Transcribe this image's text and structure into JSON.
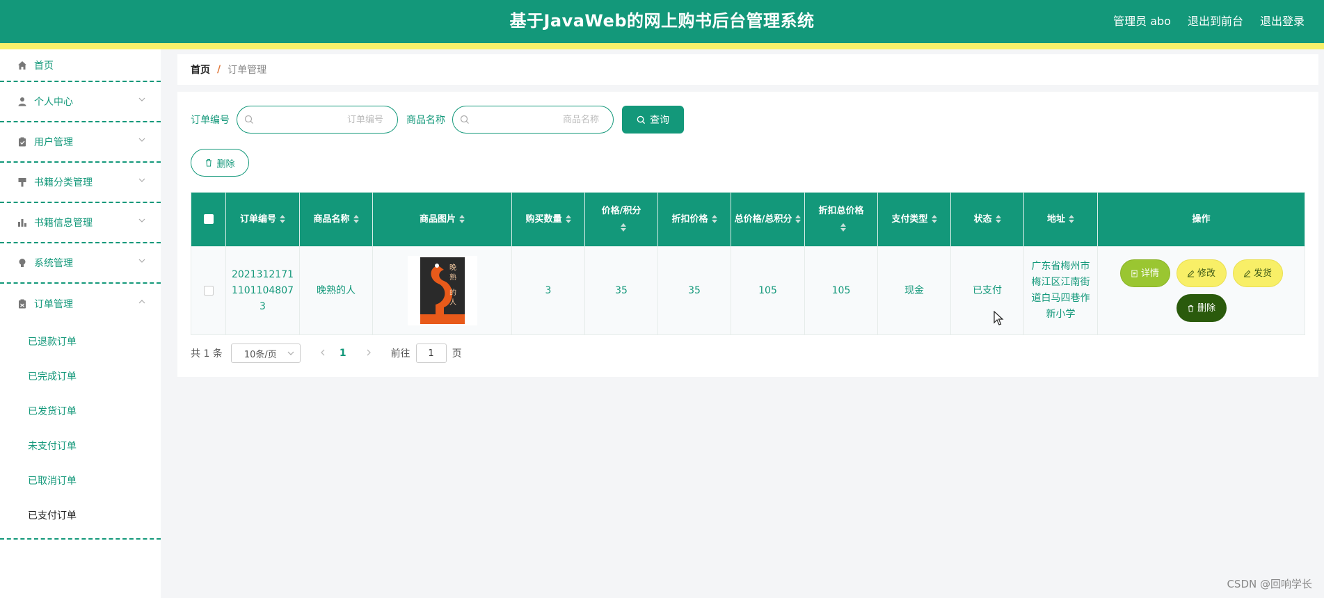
{
  "header": {
    "title": "基于JavaWeb的网上购书后台管理系统",
    "admin_label": "管理员 abo",
    "to_front": "退出到前台",
    "logout": "退出登录"
  },
  "sidebar": {
    "items": [
      {
        "label": "首页",
        "icon": "home-icon"
      },
      {
        "label": "个人中心",
        "icon": "user-icon"
      },
      {
        "label": "用户管理",
        "icon": "clipboard-icon"
      },
      {
        "label": "书籍分类管理",
        "icon": "brush-icon"
      },
      {
        "label": "书籍信息管理",
        "icon": "bar-chart-icon"
      },
      {
        "label": "系统管理",
        "icon": "bulb-icon"
      },
      {
        "label": "订单管理",
        "icon": "order-icon"
      }
    ],
    "subitems": [
      "已退款订单",
      "已完成订单",
      "已发货订单",
      "未支付订单",
      "已取消订单",
      "已支付订单"
    ]
  },
  "breadcrumb": {
    "home": "首页",
    "separator": "/",
    "current": "订单管理"
  },
  "search": {
    "order_label": "订单编号",
    "order_placeholder": "订单编号",
    "product_label": "商品名称",
    "product_placeholder": "商品名称",
    "query_button": "查询"
  },
  "delete_button": "删除",
  "table": {
    "headers": [
      "订单编号",
      "商品名称",
      "商品图片",
      "购买数量",
      "价格/积分",
      "折扣价格",
      "总价格/总积分",
      "折扣总价格",
      "支付类型",
      "状态",
      "地址",
      "操作"
    ],
    "rows": [
      {
        "order_no": "20213121711101104807 3",
        "order_no_lines": [
          "2021312171",
          "1101104807",
          "3"
        ],
        "product": "晚熟的人",
        "quantity": "3",
        "price": "35",
        "discount_price": "35",
        "total": "105",
        "discount_total": "105",
        "pay_type": "现金",
        "status": "已支付",
        "address_lines": [
          "广东省梅州市",
          "梅江区江南街",
          "道白马四巷作",
          "新小学"
        ],
        "actions": {
          "detail": "详情",
          "edit": "修改",
          "ship": "发货",
          "delete": "删除"
        }
      }
    ]
  },
  "pagination": {
    "total": "共 1 条",
    "page_size": "10条/页",
    "current_page": "1",
    "goto_label": "前往",
    "goto_value": "1",
    "page_suffix": "页"
  },
  "watermark": "CSDN @回响学长",
  "colors": {
    "primary": "#13987a",
    "stripe": "#f7f06a",
    "detail": "#9ac631",
    "edit": "#f8ef67",
    "delete": "#2a5a0c"
  }
}
